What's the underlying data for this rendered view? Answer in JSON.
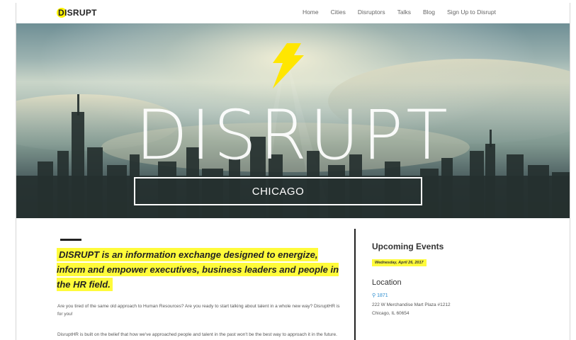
{
  "header": {
    "logo": "DISRUPT",
    "nav": [
      "Home",
      "Cities",
      "Disruptors",
      "Talks",
      "Blog",
      "Sign Up to Disrupt"
    ]
  },
  "hero": {
    "title": "DISRUPT",
    "city": "CHICAGO"
  },
  "main": {
    "lede": "DISRUPT is an information exchange designed to energize, inform and empower executives, business leaders and people in the HR field.",
    "p1": "Are you tired of the same old approach to Human Resources? Are you ready to start talking about talent in a whole new way? DisruptHR is for you!",
    "p2": "DisruptHR is built on the belief that how we've approached people and talent in the past won't be the best way to approach it in the future."
  },
  "sidebar": {
    "upcoming_title": "Upcoming Events",
    "event_date": "Wednesday, April 26, 2017",
    "location_title": "Location",
    "venue": "1871",
    "address1": "222 W Merchandise Mart Plaza #1212",
    "address2": "Chicago, IL 60654"
  },
  "colors": {
    "accent": "#fffb3a",
    "link": "#2a8ccf"
  },
  "icons": {
    "bolt": "lightning-bolt-icon",
    "pin": "map-pin-icon"
  }
}
